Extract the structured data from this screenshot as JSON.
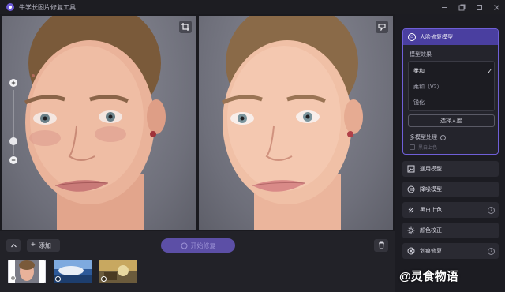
{
  "window": {
    "title": "牛学长图片修复工具",
    "controls": [
      "minimize-icon",
      "restore-icon",
      "maximize-icon",
      "close-icon"
    ]
  },
  "preview": {
    "left_corner_icon": "crop-icon",
    "right_corner_icon": "compare-icon",
    "zoom_in_label": "+",
    "zoom_out_label": "−"
  },
  "bottom": {
    "add_label": "添加",
    "start_label": "开始修复",
    "thumbnails": [
      "portrait",
      "landscape",
      "vintage"
    ]
  },
  "panel": {
    "face_model": {
      "title": "人脸修复模型",
      "subtitle": "模型效果",
      "options": [
        {
          "label": "柔和",
          "selected": true
        },
        {
          "label": "柔和（V2）",
          "selected": false
        },
        {
          "label": "锐化",
          "selected": false
        }
      ],
      "select_face_label": "选择人脸",
      "multi_face_label": "多模型处理",
      "multi_face_check": "黑白上色"
    },
    "models": [
      {
        "label": "通用模型",
        "icon": "image-icon",
        "has_arrow": false
      },
      {
        "label": "降噪模型",
        "icon": "denoise-icon",
        "has_arrow": false
      },
      {
        "label": "黑白上色",
        "icon": "palette-icon",
        "has_arrow": true
      },
      {
        "label": "颜色校正",
        "icon": "sun-icon",
        "has_arrow": false
      },
      {
        "label": "划痕修复",
        "icon": "scratch-icon",
        "has_arrow": true
      }
    ]
  },
  "watermark": "@灵食物语",
  "colors": {
    "accent": "#6f5fd8",
    "accent_dark": "#4a3fa0",
    "background": "#1a1a1f"
  }
}
